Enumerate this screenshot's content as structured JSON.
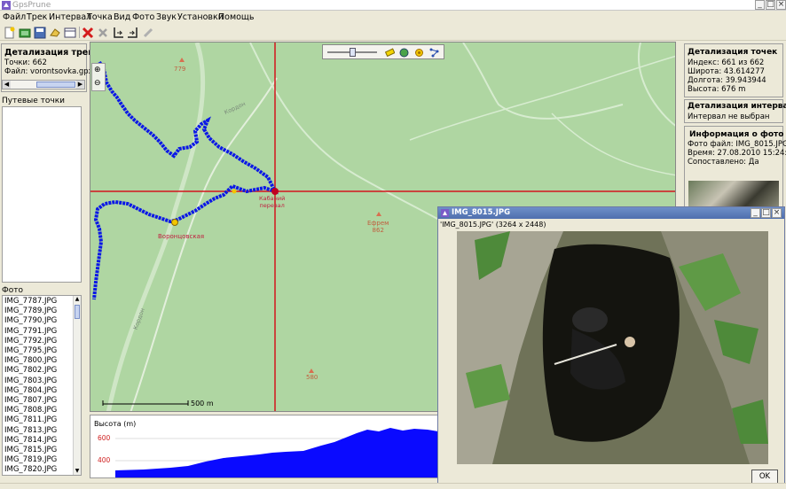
{
  "window": {
    "title": "GpsPrune"
  },
  "menu": [
    "Файл",
    "Трек",
    "Интервал",
    "Точка",
    "Вид",
    "Фото",
    "Звук",
    "Установки",
    "Помощь"
  ],
  "track_details": {
    "heading": "Детализация трека",
    "points": "Точки: 662",
    "file": "Файл: vorontsovka.gpx"
  },
  "waypoints": {
    "heading": "Путевые точки"
  },
  "photos": {
    "heading": "Фото",
    "items": [
      "IMG_7787.JPG",
      "IMG_7789.JPG",
      "IMG_7790.JPG",
      "IMG_7791.JPG",
      "IMG_7792.JPG",
      "IMG_7795.JPG",
      "IMG_7800.JPG",
      "IMG_7802.JPG",
      "IMG_7803.JPG",
      "IMG_7804.JPG",
      "IMG_7807.JPG",
      "IMG_7808.JPG",
      "IMG_7811.JPG",
      "IMG_7813.JPG",
      "IMG_7814.JPG",
      "IMG_7815.JPG",
      "IMG_7819.JPG",
      "IMG_7820.JPG"
    ]
  },
  "map": {
    "labels": {
      "peak1": "779",
      "kabanyi": "Кабаний\nперевал",
      "vorontsovskaya": "Воронцовская",
      "efrem": "Ефрем\n862",
      "peak2": "580",
      "road1": "Кордон",
      "road2": "Кордон"
    },
    "scale": "500 m",
    "zoom_slider_level": 0.5
  },
  "altitude": {
    "heading": "Высота (m)",
    "ticks": [
      "600",
      "400"
    ]
  },
  "point_details": {
    "heading": "Детализация точек",
    "index": "Индекс: 661 из 662",
    "lat": "Широта: 43.614277",
    "lon": "Долгота: 39.943944",
    "alt": "Высота: 676 m"
  },
  "range_details": {
    "heading": "Детализация интерва...",
    "status": "Интервал не выбран"
  },
  "photo_info": {
    "heading": "Информация о фото",
    "file": "Фото файл: IMG_8015.JPG",
    "time": "Время: 27.08.2010 15:24:43",
    "connected": "Сопоставлено: Да"
  },
  "photo_dialog": {
    "title": "IMG_8015.JPG",
    "caption": "'IMG_8015.JPG' (3264 x 2448)",
    "ok": "OK"
  },
  "colors": {
    "track": "#0b18e6",
    "crosshair": "#d4141c",
    "map_bg": "#afd6a2",
    "altitude_fill": "#0a0aff"
  }
}
